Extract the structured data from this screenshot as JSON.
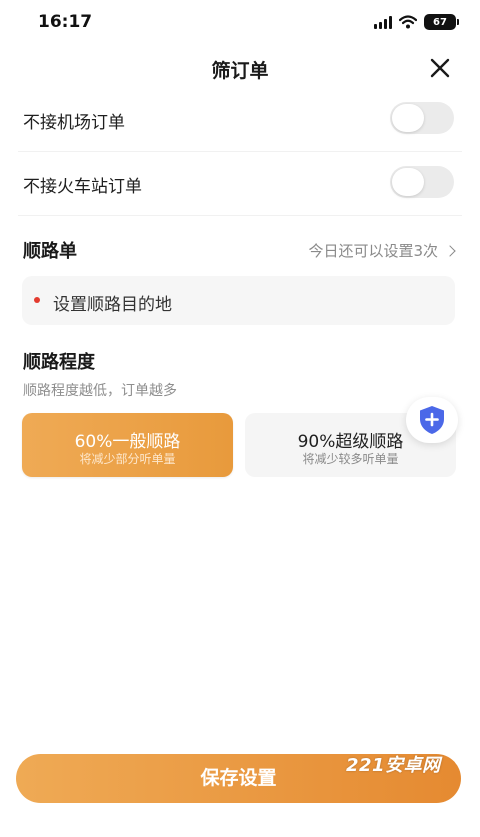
{
  "status_bar": {
    "time": "16:17",
    "battery": "67",
    "icons": [
      "signal-icon",
      "wifi-icon",
      "battery-icon"
    ]
  },
  "header": {
    "title": "筛订单",
    "close_icon": "close-icon"
  },
  "toggles": [
    {
      "label": "不接机场订单",
      "enabled": false
    },
    {
      "label": "不接火车站订单",
      "enabled": false
    }
  ],
  "shunlu": {
    "title": "顺路单",
    "hint": "今日还可以设置3次",
    "destination_label": "设置顺路目的地"
  },
  "level": {
    "title": "顺路程度",
    "description": "顺路程度越低，订单越多",
    "options": [
      {
        "title": "60%一般顺路",
        "subtitle": "将减少部分听单量",
        "selected": true
      },
      {
        "title": "90%超级顺路",
        "subtitle": "将减少较多听单量",
        "selected": false
      }
    ]
  },
  "save_button": "保存设置",
  "watermark": "221安卓网",
  "colors": {
    "accent": "#EBA04A",
    "accent_dark": "#E58A31",
    "dot_red": "#E33B2F",
    "shield_blue": "#4B68E8"
  }
}
